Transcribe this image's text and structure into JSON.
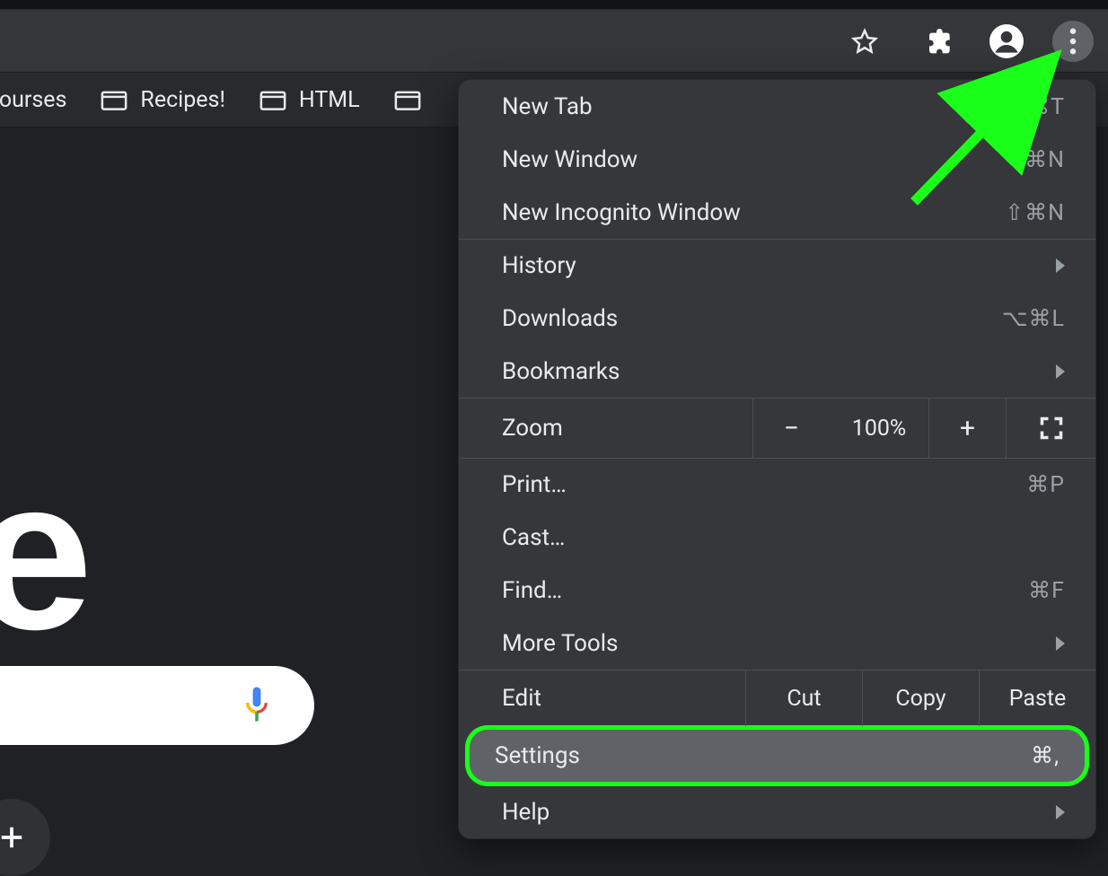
{
  "toolbar": {
    "star_title": "Bookmark this tab",
    "ext_title": "Extensions",
    "profile_title": "You",
    "kebab_title": "Customize and control Google Chrome"
  },
  "bookmarks": {
    "items": [
      "& courses",
      "Recipes!",
      "HTML"
    ]
  },
  "page": {
    "logo_fragment": "e",
    "mic_title": "Search by voice",
    "fab_title": "Add shortcut"
  },
  "menu": {
    "new_tab": {
      "label": "New Tab",
      "shortcut": "⌘T"
    },
    "new_window": {
      "label": "New Window",
      "shortcut": "⌘N"
    },
    "incognito": {
      "label": "New Incognito Window",
      "shortcut": "⇧⌘N"
    },
    "history": {
      "label": "History"
    },
    "downloads": {
      "label": "Downloads",
      "shortcut": "⌥⌘L"
    },
    "bookmarks": {
      "label": "Bookmarks"
    },
    "zoom": {
      "label": "Zoom",
      "value": "100%"
    },
    "print": {
      "label": "Print…",
      "shortcut": "⌘P"
    },
    "cast": {
      "label": "Cast…"
    },
    "find": {
      "label": "Find…",
      "shortcut": "⌘F"
    },
    "more_tools": {
      "label": "More Tools"
    },
    "edit": {
      "label": "Edit",
      "cut": "Cut",
      "copy": "Copy",
      "paste": "Paste"
    },
    "settings": {
      "label": "Settings",
      "shortcut": "⌘,"
    },
    "help": {
      "label": "Help"
    }
  },
  "annotation": {
    "kind": "arrow-to-kebab-menu",
    "color": "#19ff19"
  }
}
